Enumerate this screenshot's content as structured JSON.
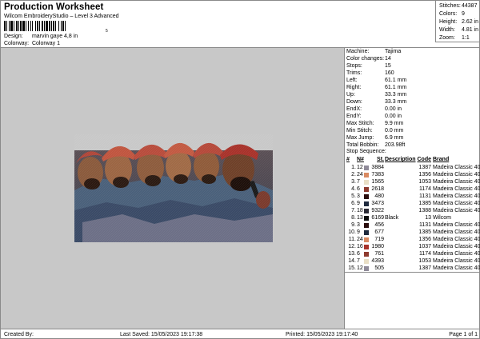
{
  "header": {
    "title": "Production Worksheet",
    "subtitle": "Wilcom EmbroideryStudio – Level 3 Advanced",
    "barcode_caption": "5",
    "design_label": "Design:",
    "design_value": "marvin gaye 4,8 in",
    "colorway_label": "Colorway:",
    "colorway_value": "Colorway 1"
  },
  "stats": [
    {
      "label": "Stitches:",
      "value": "44387"
    },
    {
      "label": "Colors:",
      "value": "9"
    },
    {
      "label": "Height:",
      "value": "2.62 in"
    },
    {
      "label": "Width:",
      "value": "4.81 in"
    },
    {
      "label": "Zoom:",
      "value": "1:1"
    }
  ],
  "machine_info": [
    {
      "label": "Machine:",
      "value": "Tajima"
    },
    {
      "label": "Color changes:",
      "value": "14"
    },
    {
      "label": "Stops:",
      "value": "15"
    },
    {
      "label": "Trims:",
      "value": "160"
    },
    {
      "label": "Left:",
      "value": "61.1 mm"
    },
    {
      "label": "Right:",
      "value": "61.1 mm"
    },
    {
      "label": "Up:",
      "value": "33.3 mm"
    },
    {
      "label": "Down:",
      "value": "33.3 mm"
    },
    {
      "label": "EndX:",
      "value": "0.00 in"
    },
    {
      "label": "EndY:",
      "value": "0.00 in"
    },
    {
      "label": "Max Stitch:",
      "value": "9.9 mm"
    },
    {
      "label": "Min Stitch:",
      "value": "0.0 mm"
    },
    {
      "label": "Max Jump:",
      "value": "6.9 mm"
    },
    {
      "label": "Total Bobbin:",
      "value": "203.98ft"
    }
  ],
  "stop_sequence": {
    "title": "Stop Sequence:",
    "headers": {
      "num": "#",
      "n": "N#",
      "st": "St.",
      "desc": "Description",
      "code": "Code",
      "brand": "Brand"
    },
    "rows": [
      {
        "num": "1.",
        "n": "12",
        "color": "#8f8a98",
        "st": "3884",
        "desc": "",
        "code": "1387",
        "brand": "Madeira Classic 40"
      },
      {
        "num": "2.",
        "n": "24",
        "color": "#d98a62",
        "st": "7383",
        "desc": "",
        "code": "1356",
        "brand": "Madeira Classic 40"
      },
      {
        "num": "3.",
        "n": "7",
        "color": "#e9dfc6",
        "st": "1565",
        "desc": "",
        "code": "1053",
        "brand": "Madeira Classic 40"
      },
      {
        "num": "4.",
        "n": "6",
        "color": "#8e3a2e",
        "st": "2618",
        "desc": "",
        "code": "1174",
        "brand": "Madeira Classic 40"
      },
      {
        "num": "5.",
        "n": "3",
        "color": "#2a0d0d",
        "st": "480",
        "desc": "",
        "code": "1131",
        "brand": "Madeira Classic 40"
      },
      {
        "num": "6.",
        "n": "9",
        "color": "#1e2a3e",
        "st": "3473",
        "desc": "",
        "code": "1385",
        "brand": "Madeira Classic 40"
      },
      {
        "num": "7.",
        "n": "18",
        "color": "#2a2a35",
        "st": "9322",
        "desc": "",
        "code": "1388",
        "brand": "Madeira Classic 40"
      },
      {
        "num": "8.",
        "n": "13",
        "color": "#0a0a0a",
        "st": "6169",
        "desc": "Black",
        "code": "13",
        "brand": "Wilcom"
      },
      {
        "num": "9.",
        "n": "3",
        "color": "#2a0d0d",
        "st": "456",
        "desc": "",
        "code": "1131",
        "brand": "Madeira Classic 40"
      },
      {
        "num": "10.",
        "n": "9",
        "color": "#1e2a3e",
        "st": "677",
        "desc": "",
        "code": "1385",
        "brand": "Madeira Classic 40"
      },
      {
        "num": "11.",
        "n": "24",
        "color": "#d98a62",
        "st": "719",
        "desc": "",
        "code": "1356",
        "brand": "Madeira Classic 40"
      },
      {
        "num": "12.",
        "n": "16",
        "color": "#a8322a",
        "st": "1980",
        "desc": "",
        "code": "1037",
        "brand": "Madeira Classic 40"
      },
      {
        "num": "13.",
        "n": "6",
        "color": "#8e3a2e",
        "st": "761",
        "desc": "",
        "code": "1174",
        "brand": "Madeira Classic 40"
      },
      {
        "num": "14.",
        "n": "7",
        "color": "#e9dfc6",
        "st": "4393",
        "desc": "",
        "code": "1053",
        "brand": "Madeira Classic 40"
      },
      {
        "num": "15.",
        "n": "12",
        "color": "#8f8a98",
        "st": "505",
        "desc": "",
        "code": "1387",
        "brand": "Madeira Classic 40"
      }
    ]
  },
  "footer": {
    "created_by": "Created By:",
    "last_saved": "Last Saved: 15/05/2023 19:17:38",
    "printed": "Printed: 15/05/2023 19:17:40",
    "page": "Page 1 of 1"
  }
}
